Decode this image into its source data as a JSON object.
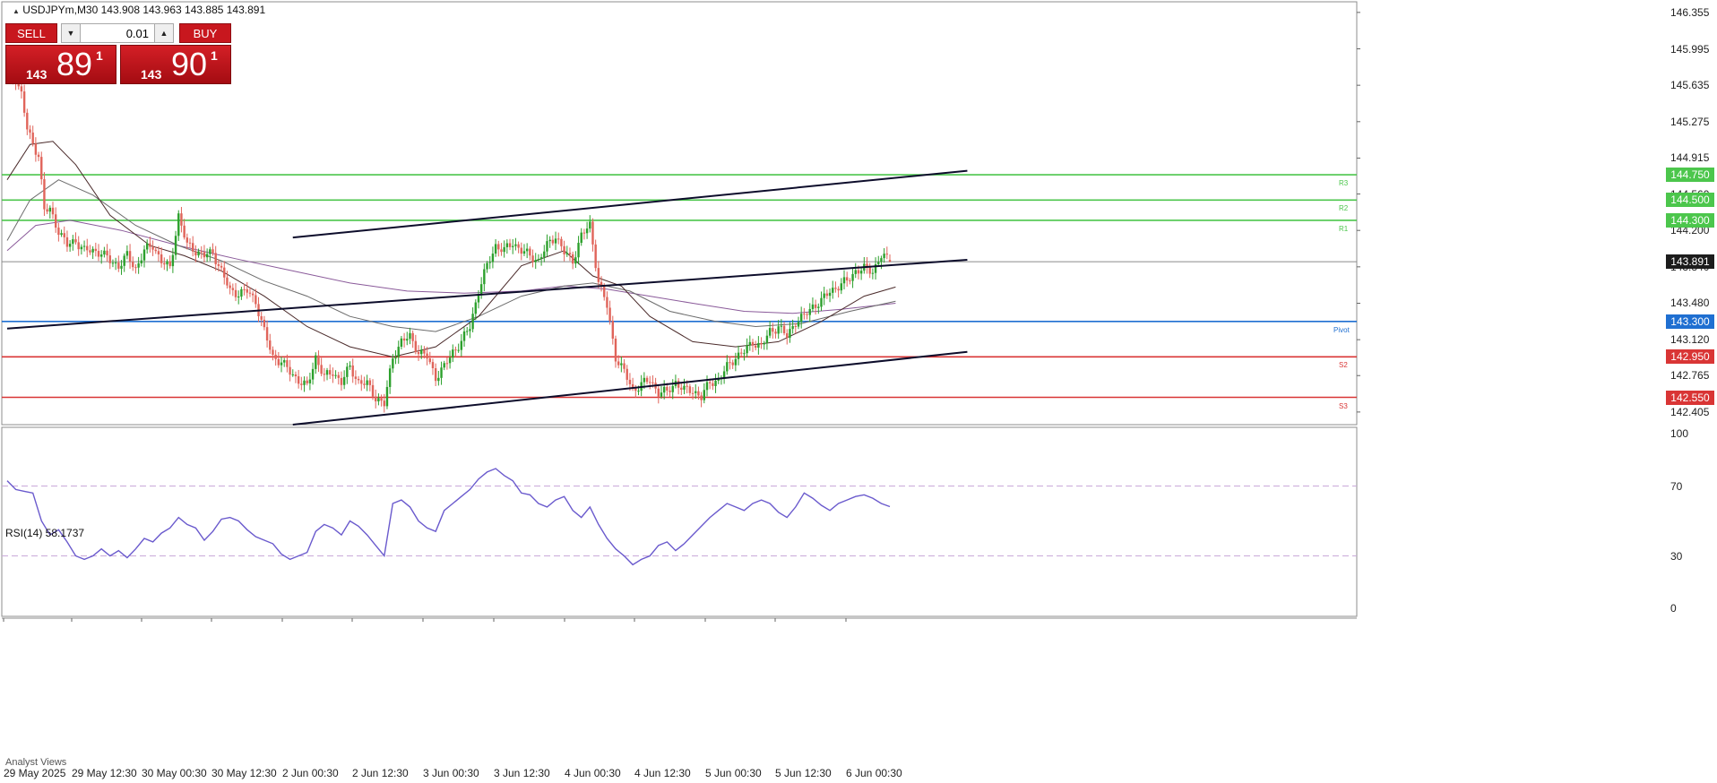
{
  "chart_header": {
    "symbol_line": "USDJPYm,M30  143.908 143.963 143.885 143.891",
    "rsi_line": "RSI(14) 58.1737",
    "analyst_tab": "Analyst Views"
  },
  "trade_panel": {
    "sell_label": "SELL",
    "buy_label": "BUY",
    "lot_value": "0.01",
    "sell_small": "143",
    "sell_big": "89",
    "sell_sup": "1",
    "buy_small": "143",
    "buy_big": "90",
    "buy_sup": "1"
  },
  "colors": {
    "bull_candle": "#2ca02c",
    "bear_candle": "#e0645a",
    "resistance": "#4cc64c",
    "support": "#d93535",
    "pivot": "#1f6fd1",
    "trend_channel": "#0d0d2b",
    "rsi_line": "#6a5acd",
    "current_price_bg": "#1c1c1c"
  },
  "chart_data": {
    "type": "candlestick",
    "symbol": "USDJPYm",
    "timeframe": "M30",
    "ohlc_last": {
      "open": 143.908,
      "high": 143.963,
      "low": 143.885,
      "close": 143.891
    },
    "price_axis_ticks": [
      "146.355",
      "145.995",
      "145.635",
      "145.275",
      "144.915",
      "144.560",
      "144.200",
      "143.840",
      "143.480",
      "143.120",
      "142.765",
      "142.405"
    ],
    "ylim": [
      142.28,
      146.46
    ],
    "x_ticks": [
      "29 May 2025",
      "29 May 12:30",
      "30 May 00:30",
      "30 May 12:30",
      "2 Jun 00:30",
      "2 Jun 12:30",
      "3 Jun 00:30",
      "3 Jun 12:30",
      "4 Jun 00:30",
      "4 Jun 12:30",
      "5 Jun 00:30",
      "5 Jun 12:30",
      "6 Jun 00:30"
    ],
    "price_levels": [
      {
        "label": "R3",
        "price": 144.75,
        "price_text": "144.750",
        "kind": "resistance"
      },
      {
        "label": "R2",
        "price": 144.5,
        "price_text": "144.500",
        "kind": "resistance"
      },
      {
        "label": "R1",
        "price": 144.3,
        "price_text": "144.300",
        "kind": "resistance"
      },
      {
        "label": "Pivot",
        "price": 143.3,
        "price_text": "143.300",
        "kind": "pivot"
      },
      {
        "label": "S2",
        "price": 142.95,
        "price_text": "142.950",
        "kind": "support"
      },
      {
        "label": "S3",
        "price": 142.55,
        "price_text": "142.550",
        "kind": "support"
      }
    ],
    "current_price": 143.891,
    "current_price_text": "143.891",
    "trend_channel": {
      "upper": [
        [
          100,
          144.13
        ],
        [
          242,
          144.79
        ]
      ],
      "middle": [
        [
          0,
          143.23
        ],
        [
          242,
          143.91
        ]
      ],
      "lower": [
        [
          100,
          142.28
        ],
        [
          242,
          143.0
        ]
      ]
    },
    "close_path": [
      [
        0,
        145.75
      ],
      [
        3,
        145.7
      ],
      [
        5,
        145.55
      ],
      [
        7,
        145.2
      ],
      [
        9,
        145.05
      ],
      [
        11,
        144.95
      ],
      [
        13,
        144.4
      ],
      [
        15,
        144.4
      ],
      [
        18,
        144.2
      ],
      [
        21,
        144.05
      ],
      [
        24,
        144.1
      ],
      [
        27,
        144.0
      ],
      [
        30,
        144.0
      ],
      [
        33,
        143.98
      ],
      [
        36,
        143.9
      ],
      [
        39,
        143.85
      ],
      [
        42,
        143.95
      ],
      [
        45,
        143.82
      ],
      [
        48,
        144.0
      ],
      [
        51,
        144.05
      ],
      [
        54,
        143.9
      ],
      [
        57,
        143.82
      ],
      [
        60,
        144.35
      ],
      [
        63,
        144.05
      ],
      [
        66,
        144.0
      ],
      [
        69,
        143.95
      ],
      [
        72,
        143.98
      ],
      [
        75,
        143.8
      ],
      [
        78,
        143.6
      ],
      [
        81,
        143.58
      ],
      [
        84,
        143.6
      ],
      [
        87,
        143.5
      ],
      [
        90,
        143.2
      ],
      [
        93,
        142.95
      ],
      [
        96,
        142.9
      ],
      [
        99,
        142.8
      ],
      [
        102,
        142.72
      ],
      [
        105,
        142.65
      ],
      [
        108,
        142.95
      ],
      [
        111,
        142.75
      ],
      [
        114,
        142.8
      ],
      [
        117,
        142.7
      ],
      [
        120,
        142.85
      ],
      [
        123,
        142.7
      ],
      [
        126,
        142.68
      ],
      [
        129,
        142.55
      ],
      [
        132,
        142.48
      ],
      [
        135,
        142.95
      ],
      [
        138,
        143.1
      ],
      [
        141,
        143.15
      ],
      [
        144,
        143.0
      ],
      [
        147,
        142.95
      ],
      [
        150,
        142.75
      ],
      [
        153,
        142.85
      ],
      [
        156,
        143.0
      ],
      [
        159,
        143.1
      ],
      [
        162,
        143.25
      ],
      [
        165,
        143.6
      ],
      [
        168,
        143.85
      ],
      [
        171,
        144.05
      ],
      [
        174,
        144.0
      ],
      [
        177,
        144.08
      ],
      [
        180,
        144.0
      ],
      [
        183,
        143.95
      ],
      [
        186,
        143.9
      ],
      [
        189,
        144.05
      ],
      [
        192,
        144.15
      ],
      [
        195,
        143.98
      ],
      [
        198,
        143.9
      ],
      [
        201,
        144.15
      ],
      [
        204,
        144.25
      ],
      [
        207,
        143.7
      ],
      [
        210,
        143.45
      ],
      [
        213,
        142.95
      ],
      [
        216,
        142.8
      ],
      [
        219,
        142.62
      ],
      [
        222,
        142.68
      ],
      [
        225,
        142.72
      ],
      [
        228,
        142.6
      ],
      [
        231,
        142.6
      ],
      [
        234,
        142.7
      ],
      [
        237,
        142.62
      ],
      [
        240,
        142.62
      ],
      [
        243,
        142.55
      ],
      [
        246,
        142.7
      ],
      [
        249,
        142.72
      ],
      [
        252,
        142.85
      ],
      [
        255,
        142.95
      ],
      [
        258,
        143.0
      ],
      [
        261,
        143.1
      ],
      [
        264,
        143.05
      ],
      [
        267,
        143.2
      ],
      [
        270,
        143.25
      ],
      [
        273,
        143.15
      ],
      [
        276,
        143.3
      ],
      [
        279,
        143.35
      ],
      [
        282,
        143.45
      ],
      [
        285,
        143.5
      ],
      [
        288,
        143.6
      ],
      [
        291,
        143.65
      ],
      [
        294,
        143.7
      ],
      [
        297,
        143.8
      ],
      [
        300,
        143.82
      ],
      [
        303,
        143.8
      ],
      [
        306,
        143.95
      ],
      [
        309,
        143.91
      ]
    ],
    "ma_fast": [
      [
        0,
        144.7
      ],
      [
        8,
        145.05
      ],
      [
        16,
        145.08
      ],
      [
        24,
        144.85
      ],
      [
        36,
        144.35
      ],
      [
        50,
        144.05
      ],
      [
        62,
        143.95
      ],
      [
        75,
        143.8
      ],
      [
        90,
        143.55
      ],
      [
        105,
        143.25
      ],
      [
        120,
        143.05
      ],
      [
        135,
        142.95
      ],
      [
        150,
        143.05
      ],
      [
        165,
        143.35
      ],
      [
        180,
        143.85
      ],
      [
        195,
        144.0
      ],
      [
        205,
        143.75
      ],
      [
        215,
        143.65
      ],
      [
        225,
        143.35
      ],
      [
        240,
        143.1
      ],
      [
        255,
        143.05
      ],
      [
        270,
        143.1
      ],
      [
        285,
        143.3
      ],
      [
        300,
        143.55
      ],
      [
        311,
        143.64
      ]
    ],
    "ma_mid": [
      [
        0,
        144.1
      ],
      [
        8,
        144.5
      ],
      [
        18,
        144.7
      ],
      [
        30,
        144.55
      ],
      [
        45,
        144.25
      ],
      [
        60,
        144.05
      ],
      [
        75,
        143.9
      ],
      [
        90,
        143.7
      ],
      [
        105,
        143.55
      ],
      [
        120,
        143.35
      ],
      [
        135,
        143.25
      ],
      [
        150,
        143.2
      ],
      [
        165,
        143.35
      ],
      [
        180,
        143.55
      ],
      [
        195,
        143.65
      ],
      [
        205,
        143.68
      ],
      [
        218,
        143.6
      ],
      [
        232,
        143.4
      ],
      [
        248,
        143.3
      ],
      [
        262,
        143.25
      ],
      [
        278,
        143.28
      ],
      [
        295,
        143.4
      ],
      [
        311,
        143.5
      ]
    ],
    "ma_slow": [
      [
        0,
        144.0
      ],
      [
        10,
        144.25
      ],
      [
        22,
        144.3
      ],
      [
        40,
        144.2
      ],
      [
        60,
        144.05
      ],
      [
        80,
        143.92
      ],
      [
        100,
        143.8
      ],
      [
        120,
        143.68
      ],
      [
        140,
        143.6
      ],
      [
        160,
        143.58
      ],
      [
        180,
        143.6
      ],
      [
        195,
        143.65
      ],
      [
        210,
        143.62
      ],
      [
        225,
        143.55
      ],
      [
        240,
        143.48
      ],
      [
        258,
        143.4
      ],
      [
        275,
        143.38
      ],
      [
        292,
        143.42
      ],
      [
        311,
        143.48
      ]
    ],
    "rsi": {
      "value_text": "58.1737",
      "levels": [
        70,
        30
      ],
      "ticks": [
        "100",
        "70",
        "30",
        "0"
      ],
      "values": [
        [
          0,
          73
        ],
        [
          3,
          68
        ],
        [
          6,
          67
        ],
        [
          9,
          66
        ],
        [
          12,
          50
        ],
        [
          15,
          42
        ],
        [
          18,
          45
        ],
        [
          21,
          38
        ],
        [
          24,
          30
        ],
        [
          27,
          28
        ],
        [
          30,
          30
        ],
        [
          33,
          34
        ],
        [
          36,
          30
        ],
        [
          39,
          33
        ],
        [
          42,
          29
        ],
        [
          45,
          34
        ],
        [
          48,
          40
        ],
        [
          51,
          38
        ],
        [
          54,
          43
        ],
        [
          57,
          46
        ],
        [
          60,
          52
        ],
        [
          63,
          48
        ],
        [
          66,
          46
        ],
        [
          69,
          39
        ],
        [
          72,
          44
        ],
        [
          75,
          51
        ],
        [
          78,
          52
        ],
        [
          81,
          50
        ],
        [
          84,
          45
        ],
        [
          87,
          41
        ],
        [
          90,
          39
        ],
        [
          93,
          37
        ],
        [
          96,
          31
        ],
        [
          99,
          28
        ],
        [
          102,
          30
        ],
        [
          105,
          32
        ],
        [
          108,
          44
        ],
        [
          111,
          48
        ],
        [
          114,
          46
        ],
        [
          117,
          42
        ],
        [
          120,
          50
        ],
        [
          123,
          47
        ],
        [
          126,
          42
        ],
        [
          129,
          36
        ],
        [
          132,
          30
        ],
        [
          135,
          60
        ],
        [
          138,
          62
        ],
        [
          141,
          58
        ],
        [
          144,
          50
        ],
        [
          147,
          46
        ],
        [
          150,
          44
        ],
        [
          153,
          56
        ],
        [
          156,
          60
        ],
        [
          159,
          64
        ],
        [
          162,
          68
        ],
        [
          165,
          74
        ],
        [
          168,
          78
        ],
        [
          171,
          80
        ],
        [
          174,
          76
        ],
        [
          177,
          73
        ],
        [
          180,
          66
        ],
        [
          183,
          65
        ],
        [
          186,
          60
        ],
        [
          189,
          58
        ],
        [
          192,
          62
        ],
        [
          195,
          64
        ],
        [
          198,
          56
        ],
        [
          201,
          52
        ],
        [
          204,
          58
        ],
        [
          207,
          48
        ],
        [
          210,
          40
        ],
        [
          213,
          34
        ],
        [
          216,
          30
        ],
        [
          219,
          25
        ],
        [
          222,
          28
        ],
        [
          225,
          30
        ],
        [
          228,
          36
        ],
        [
          231,
          38
        ],
        [
          234,
          33
        ],
        [
          237,
          37
        ],
        [
          240,
          42
        ],
        [
          243,
          47
        ],
        [
          246,
          52
        ],
        [
          249,
          56
        ],
        [
          252,
          60
        ],
        [
          255,
          58
        ],
        [
          258,
          56
        ],
        [
          261,
          60
        ],
        [
          264,
          62
        ],
        [
          267,
          60
        ],
        [
          270,
          55
        ],
        [
          273,
          52
        ],
        [
          276,
          58
        ],
        [
          279,
          66
        ],
        [
          282,
          63
        ],
        [
          285,
          59
        ],
        [
          288,
          56
        ],
        [
          291,
          60
        ],
        [
          294,
          62
        ],
        [
          297,
          64
        ],
        [
          300,
          65
        ],
        [
          303,
          63
        ],
        [
          306,
          60
        ],
        [
          309,
          58.2
        ]
      ]
    }
  }
}
